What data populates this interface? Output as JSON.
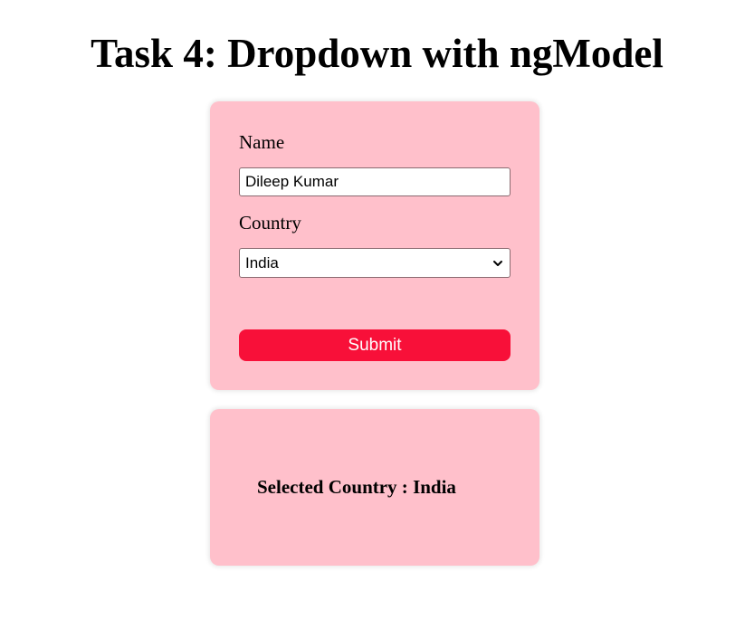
{
  "page": {
    "title": "Task 4: Dropdown with ngModel"
  },
  "form": {
    "name_label": "Name",
    "name_value": "Dileep Kumar",
    "country_label": "Country",
    "country_selected": "India",
    "submit_label": "Submit"
  },
  "result": {
    "prefix": "Selected Country : ",
    "country": "India"
  },
  "colors": {
    "card_background": "#ffc0cb",
    "button_background": "#f81039",
    "button_text": "#ffffff"
  },
  "icons": {
    "select_chevron": "chevron-down-icon"
  }
}
